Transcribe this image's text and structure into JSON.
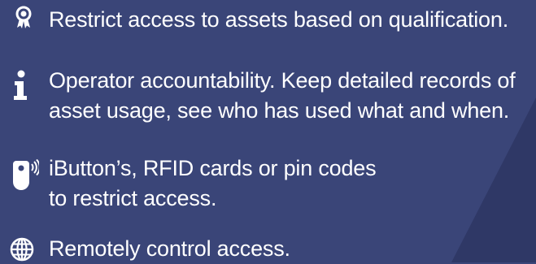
{
  "features": [
    {
      "icon": "award-ribbon-icon",
      "lines": [
        "Restrict access to assets based on qualification."
      ]
    },
    {
      "icon": "info-icon",
      "lines": [
        "Operator accountability. Keep detailed records of",
        "asset usage, see who has used what and when."
      ]
    },
    {
      "icon": "rfid-fob-icon",
      "lines": [
        "iButton’s, RFID cards or pin codes",
        "to restrict access."
      ]
    },
    {
      "icon": "globe-icon",
      "lines": [
        "Remotely control access."
      ]
    }
  ],
  "colors": {
    "background": "#3a4578",
    "background_shape": "#2f3866",
    "text": "#ffffff"
  }
}
